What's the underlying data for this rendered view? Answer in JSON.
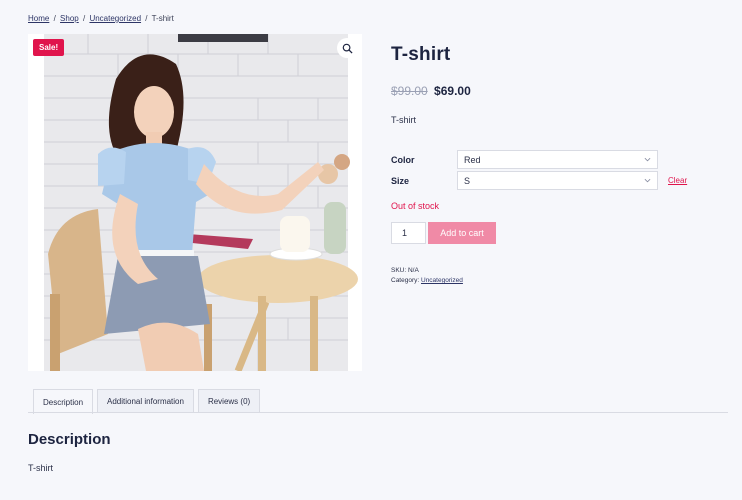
{
  "breadcrumb": {
    "home": "Home",
    "shop": "Shop",
    "category": "Uncategorized",
    "current": "T-shirt",
    "separator": "/"
  },
  "gallery": {
    "sale_badge": "Sale!",
    "zoom_icon": "search-icon"
  },
  "product": {
    "title": "T-shirt",
    "price_old": "$99.00",
    "price_new": "$69.00",
    "short_description": "T-shirt"
  },
  "variations": {
    "color_label": "Color",
    "color_value": "Red",
    "size_label": "Size",
    "size_value": "S",
    "clear_label": "Clear"
  },
  "stock_status": "Out of stock",
  "cart": {
    "quantity": "1",
    "add_to_cart_label": "Add to cart"
  },
  "meta": {
    "sku_label": "SKU:",
    "sku_value": "N/A",
    "category_label": "Category:",
    "category_value": "Uncategorized"
  },
  "tabs": {
    "description": "Description",
    "additional": "Additional information",
    "reviews": "Reviews (0)"
  },
  "description": {
    "heading": "Description",
    "text": "T-shirt"
  },
  "colors": {
    "accent": "#e0144c",
    "button_disabled": "#f08aa6",
    "text_dark": "#1d2440"
  }
}
